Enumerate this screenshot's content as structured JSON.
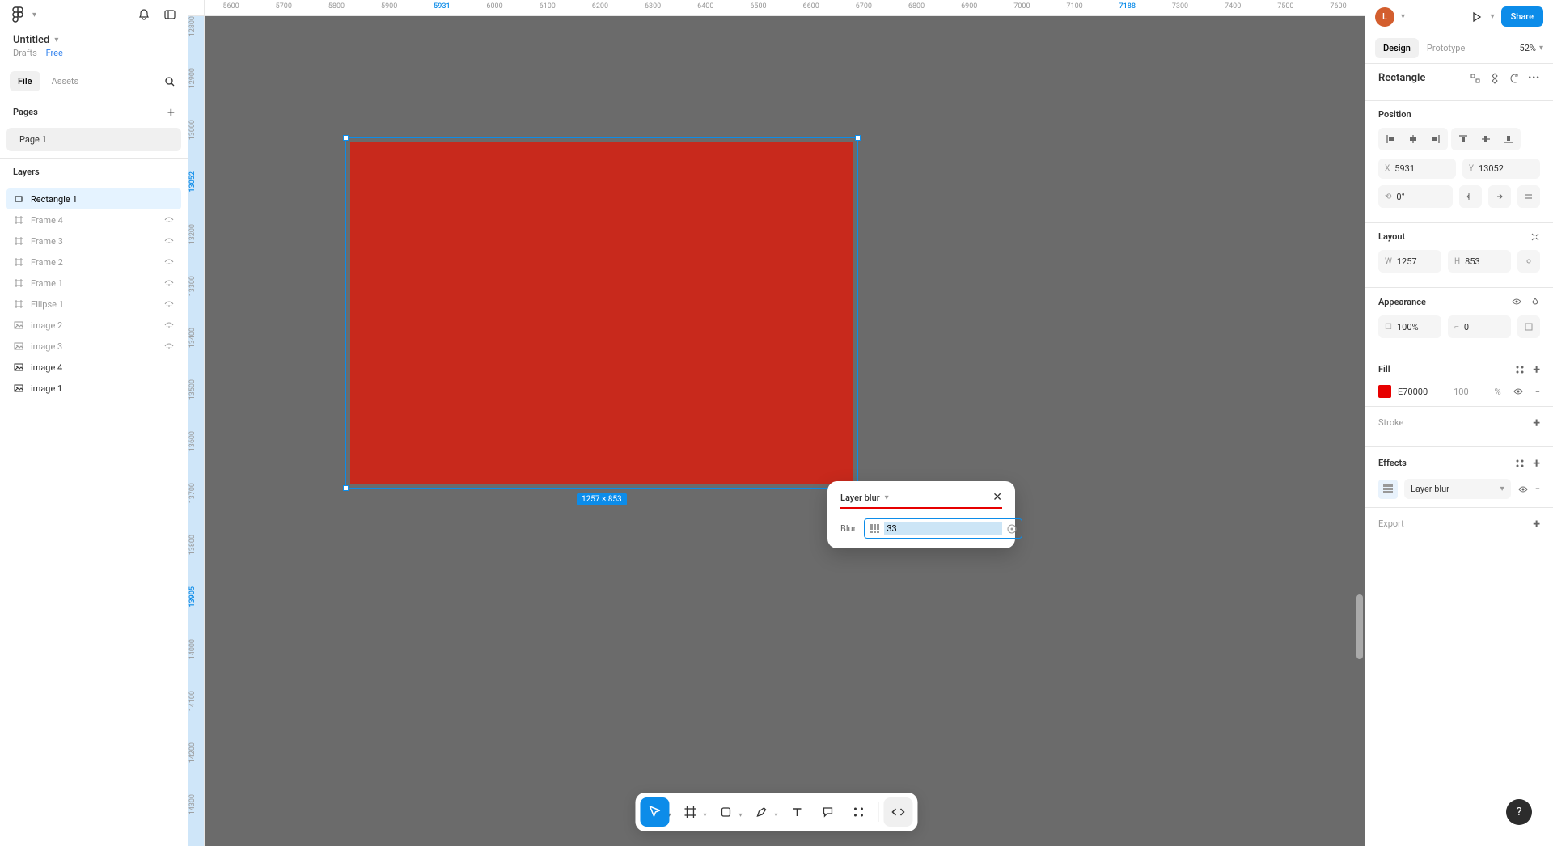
{
  "header": {
    "title": "Untitled",
    "drafts": "Drafts",
    "plan": "Free"
  },
  "left_tabs": {
    "file": "File",
    "assets": "Assets"
  },
  "pages": {
    "heading": "Pages",
    "items": [
      "Page 1"
    ]
  },
  "layers": {
    "heading": "Layers",
    "items": [
      {
        "name": "Rectangle 1",
        "type": "rect",
        "selected": true,
        "hidden": false
      },
      {
        "name": "Frame 4",
        "type": "frame",
        "selected": false,
        "hidden": true
      },
      {
        "name": "Frame 3",
        "type": "frame",
        "selected": false,
        "hidden": true
      },
      {
        "name": "Frame 2",
        "type": "frame",
        "selected": false,
        "hidden": true
      },
      {
        "name": "Frame 1",
        "type": "frame",
        "selected": false,
        "hidden": true
      },
      {
        "name": "Ellipse 1",
        "type": "frame",
        "selected": false,
        "hidden": true
      },
      {
        "name": "image 2",
        "type": "image",
        "selected": false,
        "hidden": true
      },
      {
        "name": "image 3",
        "type": "image",
        "selected": false,
        "hidden": true
      },
      {
        "name": "image 4",
        "type": "image",
        "selected": false,
        "hidden": false
      },
      {
        "name": "image 1",
        "type": "image",
        "selected": false,
        "hidden": false
      }
    ]
  },
  "ruler_h": [
    "5600",
    "5700",
    "5800",
    "5900",
    "5931",
    "6000",
    "6100",
    "6200",
    "6300",
    "6400",
    "6500",
    "6600",
    "6700",
    "6800",
    "6900",
    "7000",
    "7100",
    "7188",
    "7300",
    "7400",
    "7500",
    "7600"
  ],
  "ruler_h_hl": [
    4,
    17
  ],
  "ruler_v": [
    "12800",
    "12900",
    "13000",
    "13052",
    "13200",
    "13300",
    "13400",
    "13500",
    "13600",
    "13700",
    "13800",
    "13905",
    "14000",
    "14100",
    "14200",
    "14300"
  ],
  "ruler_v_hl": [
    3,
    11
  ],
  "selection": {
    "dim_label": "1257 × 853",
    "fill_color": "#c8291c"
  },
  "popup": {
    "title": "Layer blur",
    "field_label": "Blur",
    "field_value": "33"
  },
  "right": {
    "avatar": "L",
    "share": "Share",
    "tabs": {
      "design": "Design",
      "prototype": "Prototype"
    },
    "zoom": "52%",
    "selection_name": "Rectangle",
    "position": {
      "heading": "Position",
      "x": "5931",
      "y": "13052",
      "rotation": "0°"
    },
    "layout": {
      "heading": "Layout",
      "w": "1257",
      "h": "853"
    },
    "appearance": {
      "heading": "Appearance",
      "opacity": "100%",
      "radius": "0"
    },
    "fill": {
      "heading": "Fill",
      "hex": "E70000",
      "pct": "100",
      "pct_sym": "%"
    },
    "stroke": {
      "heading": "Stroke"
    },
    "effects": {
      "heading": "Effects",
      "type": "Layer blur"
    },
    "export": {
      "heading": "Export"
    }
  }
}
